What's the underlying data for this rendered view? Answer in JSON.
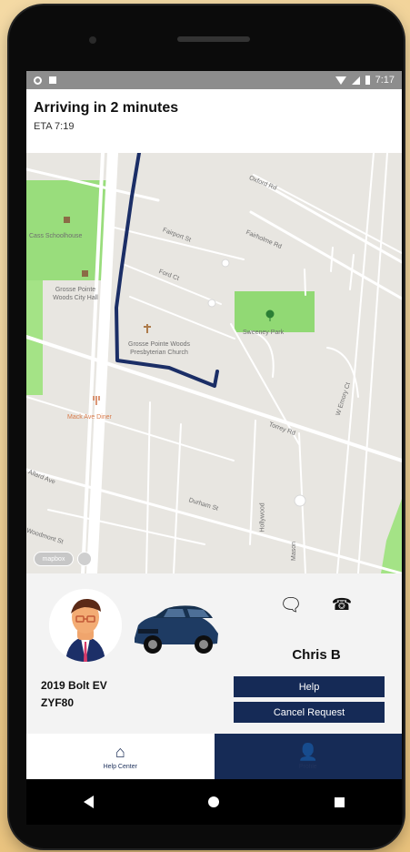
{
  "status_bar": {
    "time": "7:17"
  },
  "header": {
    "title": "Arriving in 2 minutes",
    "eta": "ETA 7:19"
  },
  "map": {
    "labels": [
      "Oxford Rd",
      "Fairholme Rd",
      "Fairport St",
      "Ford Ct",
      "Cass Schoolhouse",
      "Grosse Pointe Woods City Hall",
      "Sweeney Park",
      "Grosse Pointe Woods Presbyterian Church",
      "Torrey Rd",
      "Mack Ave Diner",
      "Allard Ave",
      "Durham St",
      "Woodmont St",
      "Hollywood",
      "W Emory Ct",
      "Mason"
    ],
    "credit": "mapbox"
  },
  "driver_panel": {
    "driver_name": "Chris B",
    "car_model": "2019 Bolt EV",
    "plate": "ZYF80",
    "help_label": "Help",
    "cancel_label": "Cancel Request"
  },
  "bottom_nav": {
    "home_label": "Help Center",
    "profile_label": "Profile"
  },
  "colors": {
    "navy": "#152a56",
    "map_background": "#e8e6e1",
    "park_green": "#8cd86e",
    "route": "#1b2e66"
  }
}
